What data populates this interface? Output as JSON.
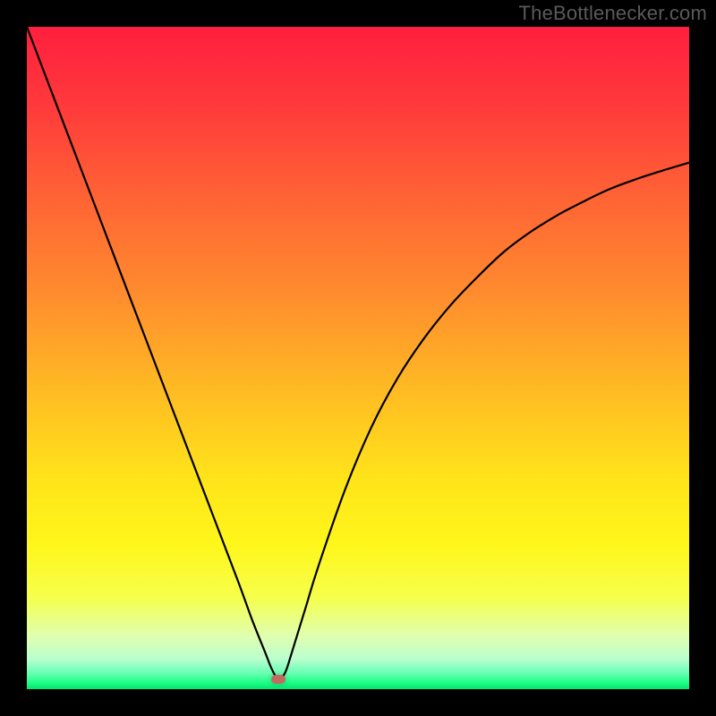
{
  "watermark": "TheBottlenecker.com",
  "chart_data": {
    "type": "line",
    "title": "",
    "xlabel": "",
    "ylabel": "",
    "xlim": [
      0,
      100
    ],
    "ylim": [
      0,
      100
    ],
    "minimum_x": 38,
    "marker": {
      "x": 38,
      "y": 1.5,
      "color": "#c26a60"
    },
    "series": [
      {
        "name": "bottleneck-curve",
        "x": [
          0,
          4,
          8,
          12,
          16,
          20,
          24,
          28,
          32,
          34,
          36,
          37,
          38,
          39,
          40,
          42,
          44,
          48,
          52,
          56,
          60,
          64,
          68,
          72,
          76,
          80,
          84,
          88,
          92,
          96,
          100
        ],
        "y": [
          100,
          89.5,
          79,
          68.5,
          58,
          47.5,
          37,
          26.5,
          16,
          10.5,
          5.5,
          3.0,
          1.5,
          2.5,
          5.5,
          12,
          18.5,
          30,
          39.5,
          47,
          53,
          58,
          62.2,
          66,
          69,
          71.5,
          73.6,
          75.5,
          77,
          78.3,
          79.5
        ]
      }
    ],
    "gradient_stops": [
      {
        "offset": 0,
        "color": "#ff1f3f"
      },
      {
        "offset": 0.12,
        "color": "#ff3a3b"
      },
      {
        "offset": 0.25,
        "color": "#ff6135"
      },
      {
        "offset": 0.4,
        "color": "#ff8b2e"
      },
      {
        "offset": 0.55,
        "color": "#ffbb23"
      },
      {
        "offset": 0.68,
        "color": "#ffe31a"
      },
      {
        "offset": 0.78,
        "color": "#fff61a"
      },
      {
        "offset": 0.86,
        "color": "#f6ff4a"
      },
      {
        "offset": 0.92,
        "color": "#e0ffb0"
      },
      {
        "offset": 0.955,
        "color": "#b9ffce"
      },
      {
        "offset": 0.975,
        "color": "#6bffb5"
      },
      {
        "offset": 0.99,
        "color": "#1eff86"
      },
      {
        "offset": 1.0,
        "color": "#00e66e"
      }
    ]
  }
}
